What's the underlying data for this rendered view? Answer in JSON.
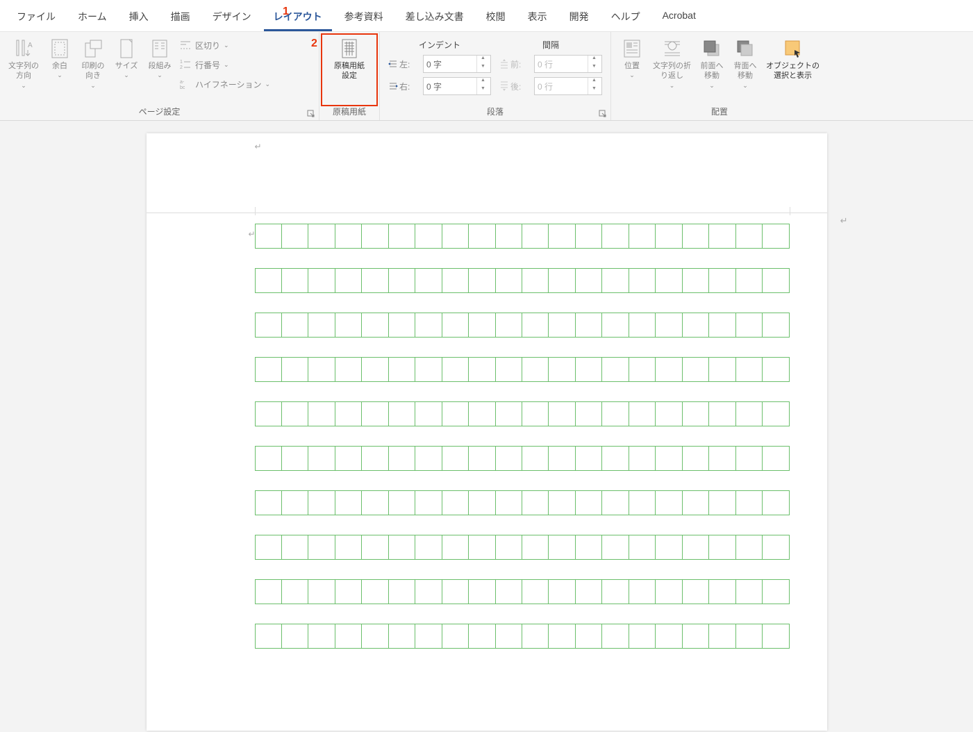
{
  "tabs": [
    "ファイル",
    "ホーム",
    "挿入",
    "描画",
    "デザイン",
    "レイアウト",
    "参考資料",
    "差し込み文書",
    "校閲",
    "表示",
    "開発",
    "ヘルプ",
    "Acrobat"
  ],
  "activeTab": "レイアウト",
  "annotations": {
    "n1": "1",
    "n2": "2"
  },
  "groups": {
    "pageSetup": {
      "label": "ページ設定",
      "textDirection": "文字列の\n方向",
      "margins": "余白",
      "orientation": "印刷の\n向き",
      "size": "サイズ",
      "columns": "段組み",
      "breaks": "区切り",
      "lineNumbers": "行番号",
      "hyphenation": "ハイフネーション"
    },
    "manuscript": {
      "label": "原稿用紙",
      "button": "原稿用紙\n設定"
    },
    "paragraph": {
      "label": "段落",
      "indentHeader": "インデント",
      "spacingHeader": "間隔",
      "left": "左:",
      "right": "右:",
      "before": "前:",
      "after": "後:",
      "leftVal": "0 字",
      "rightVal": "0 字",
      "beforeVal": "0 行",
      "afterVal": "0 行"
    },
    "arrange": {
      "label": "配置",
      "position": "位置",
      "wrap": "文字列の折\nり返し",
      "bringForward": "前面へ\n移動",
      "sendBackward": "背面へ\n移動",
      "selectionPane": "オブジェクトの\n選択と表示"
    }
  }
}
